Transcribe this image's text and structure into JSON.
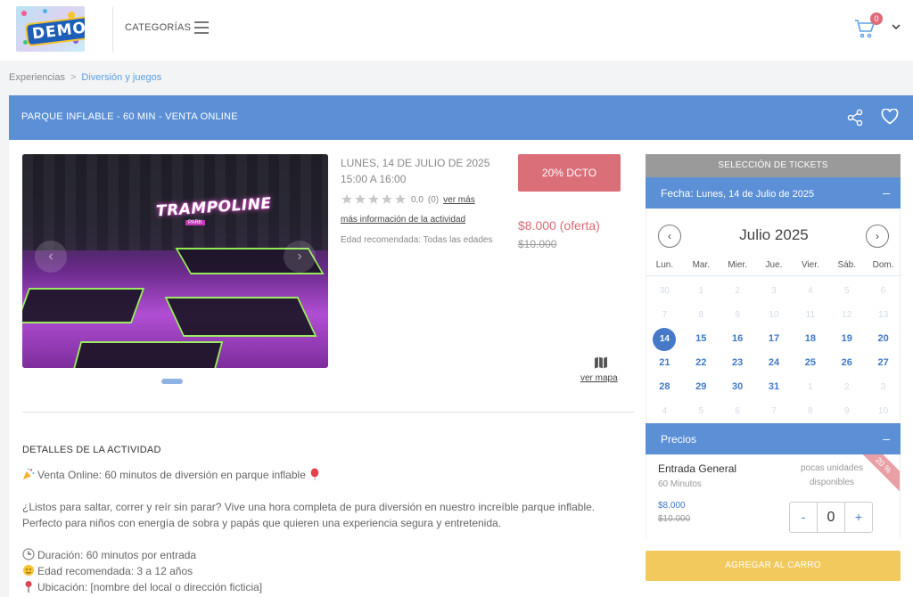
{
  "header": {
    "logo_text": "DEMO",
    "categories_label": "CATEGORÍAS",
    "cart_count": "0"
  },
  "breadcrumb": {
    "items": [
      "Experiencias",
      "Diversión y juegos"
    ],
    "separator": ">"
  },
  "product": {
    "title": "PARQUE INFLABLE - 60 MIN - VENTA ONLINE",
    "date": "LUNES, 14 DE JULIO DE 2025",
    "time": "15:00 A 16:00",
    "rating_value": "0,0",
    "rating_count": "(0)",
    "rating_link": "ver más",
    "more_info_link": "más información de la actividad",
    "age_label": "Edad recomendada: Todas las edades",
    "discount_label": "20% DCTO",
    "price_offer": "$8.000 (oferta)",
    "price_original": "$10.000",
    "map_link": "ver mapa",
    "image_sign": "TRAMPOLINE",
    "image_sign_sub": "PARK"
  },
  "details": {
    "title": "DETALLES DE LA ACTIVIDAD",
    "intro": "Venta Online: 60 minutos de diversión en parque inflable",
    "paragraph": "¿Listos para saltar, correr y reír sin parar? Vive una hora completa de pura diversión en nuestro increíble parque inflable. Perfecto para niños con energía de sobra y papás que quieren una experiencia segura y entretenida.",
    "duration": "Duración: 60 minutos por entrada",
    "age": "Edad recomendada: 3 a 12 años",
    "location": "Ubicación: [nombre del local o dirección ficticia]"
  },
  "tickets": {
    "header": "SELECCIÓN DE TICKETS",
    "fecha_label": "Fecha:",
    "fecha_value": "Lunes, 14 de Julio de 2025",
    "month": "Julio 2025",
    "weekdays": [
      "Lun.",
      "Mar.",
      "Mier.",
      "Jue.",
      "Vier.",
      "Sáb.",
      "Dom."
    ],
    "weeks": [
      [
        {
          "d": "30",
          "s": "off"
        },
        {
          "d": "1",
          "s": "off"
        },
        {
          "d": "2",
          "s": "off"
        },
        {
          "d": "3",
          "s": "off"
        },
        {
          "d": "4",
          "s": "off"
        },
        {
          "d": "5",
          "s": "off"
        },
        {
          "d": "6",
          "s": "off"
        }
      ],
      [
        {
          "d": "7",
          "s": "off"
        },
        {
          "d": "8",
          "s": "off"
        },
        {
          "d": "9",
          "s": "off"
        },
        {
          "d": "10",
          "s": "off"
        },
        {
          "d": "11",
          "s": "off"
        },
        {
          "d": "12",
          "s": "off"
        },
        {
          "d": "13",
          "s": "off"
        }
      ],
      [
        {
          "d": "14",
          "s": "sel"
        },
        {
          "d": "15",
          "s": "on"
        },
        {
          "d": "16",
          "s": "on"
        },
        {
          "d": "17",
          "s": "on"
        },
        {
          "d": "18",
          "s": "on"
        },
        {
          "d": "19",
          "s": "on"
        },
        {
          "d": "20",
          "s": "on"
        }
      ],
      [
        {
          "d": "21",
          "s": "on"
        },
        {
          "d": "22",
          "s": "on"
        },
        {
          "d": "23",
          "s": "on"
        },
        {
          "d": "24",
          "s": "on"
        },
        {
          "d": "25",
          "s": "on"
        },
        {
          "d": "26",
          "s": "on"
        },
        {
          "d": "27",
          "s": "on"
        }
      ],
      [
        {
          "d": "28",
          "s": "on"
        },
        {
          "d": "29",
          "s": "on"
        },
        {
          "d": "30",
          "s": "on"
        },
        {
          "d": "31",
          "s": "on"
        },
        {
          "d": "1",
          "s": "off"
        },
        {
          "d": "2",
          "s": "off"
        },
        {
          "d": "3",
          "s": "off"
        }
      ],
      [
        {
          "d": "4",
          "s": "off"
        },
        {
          "d": "5",
          "s": "off"
        },
        {
          "d": "6",
          "s": "off"
        },
        {
          "d": "7",
          "s": "off"
        },
        {
          "d": "8",
          "s": "off"
        },
        {
          "d": "9",
          "s": "off"
        },
        {
          "d": "10",
          "s": "off"
        }
      ]
    ],
    "precios_label": "Precios",
    "collapse_symbol": "–",
    "ticket_name": "Entrada General",
    "ticket_sub": "60 Minutos",
    "ticket_price": "$8.000",
    "ticket_old_price": "$10.000",
    "stock_note": "pocas unidades disponibles",
    "ribbon": "20 %",
    "minus": "-",
    "quantity": "0",
    "plus": "+",
    "add_button": "AGREGAR AL CARRO"
  },
  "colors": {
    "primary_blue": "#5b8fd6",
    "discount_red": "#db6f78",
    "add_yellow": "#f2c95c"
  }
}
